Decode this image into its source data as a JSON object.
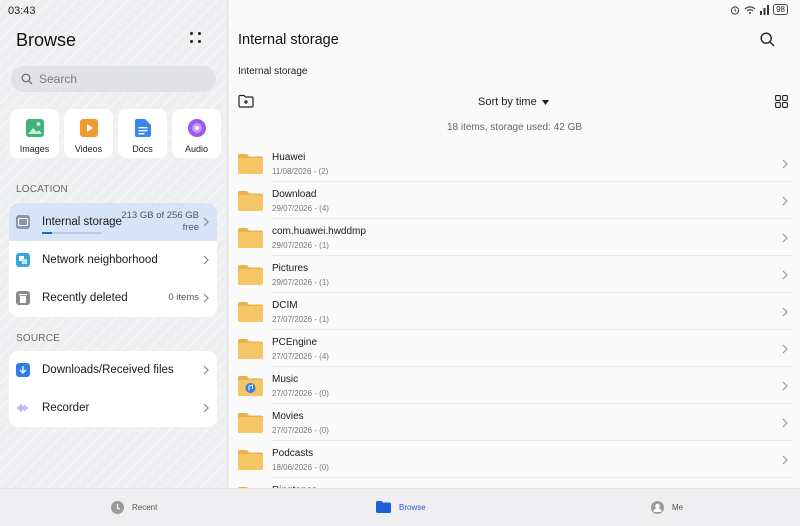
{
  "status": {
    "time": "03:43",
    "battery": "98"
  },
  "sidebar": {
    "title": "Browse",
    "search_placeholder": "Search",
    "categories": [
      {
        "label": "Images",
        "icon": "images-icon"
      },
      {
        "label": "Videos",
        "icon": "videos-icon"
      },
      {
        "label": "Docs",
        "icon": "docs-icon"
      },
      {
        "label": "Audio",
        "icon": "audio-icon"
      }
    ],
    "location_label": "LOCATION",
    "location_items": [
      {
        "label": "Internal storage",
        "info": "213 GB of 256 GB free",
        "usage_fraction": 0.17
      },
      {
        "label": "Network neighborhood",
        "info": ""
      },
      {
        "label": "Recently deleted",
        "info": "0 items"
      }
    ],
    "source_label": "SOURCE",
    "source_items": [
      {
        "label": "Downloads/Received files"
      },
      {
        "label": "Recorder"
      }
    ]
  },
  "main": {
    "title": "Internal storage",
    "breadcrumb": "Internal storage",
    "sort_label": "Sort by time",
    "summary": "18 items, storage used: 42 GB",
    "files": [
      {
        "name": "Huawei",
        "meta": "11/08/2026 - (2)"
      },
      {
        "name": "Download",
        "meta": "29/07/2026 - (4)"
      },
      {
        "name": "com.huawei.hwddmp",
        "meta": "29/07/2026 - (1)"
      },
      {
        "name": "Pictures",
        "meta": "29/07/2026 - (1)"
      },
      {
        "name": "DCIM",
        "meta": "27/07/2026 - (1)"
      },
      {
        "name": "PCEngine",
        "meta": "27/07/2026 - (4)"
      },
      {
        "name": "Music",
        "meta": "27/07/2026 - (0)"
      },
      {
        "name": "Movies",
        "meta": "27/07/2026 - (0)"
      },
      {
        "name": "Podcasts",
        "meta": "18/06/2026 - (0)"
      },
      {
        "name": "Ringtones",
        "meta": ""
      }
    ]
  },
  "bottom_nav": [
    {
      "label": "Recent"
    },
    {
      "label": "Browse"
    },
    {
      "label": "Me"
    }
  ],
  "colors": {
    "accent": "#1f5ed6",
    "folder": "#f5c665",
    "folder_dark": "#e9b24c"
  }
}
